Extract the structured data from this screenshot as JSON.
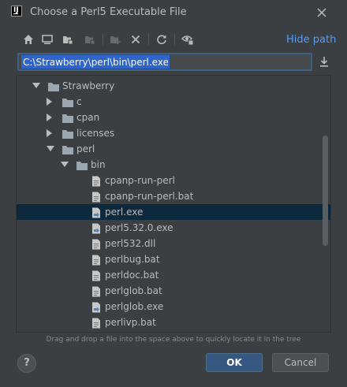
{
  "window": {
    "title": "Choose a Perl5 Executable File",
    "app_icon": "intellij-logo-icon"
  },
  "toolbar": {
    "buttons": [
      "home-icon",
      "desktop-icon",
      "project-folder-icon",
      "module-folder-icon",
      "new-folder-icon",
      "delete-icon",
      "refresh-icon",
      "show-hidden-icon"
    ],
    "hide_path_label": "Hide path"
  },
  "path": {
    "value": "C:\\Strawberry\\perl\\bin\\perl.exe"
  },
  "tree": {
    "rows": [
      {
        "label": "Strawberry",
        "type": "folder",
        "expanded": true
      },
      {
        "label": "c",
        "type": "folder",
        "expanded": false
      },
      {
        "label": "cpan",
        "type": "folder",
        "expanded": false
      },
      {
        "label": "licenses",
        "type": "folder",
        "expanded": false
      },
      {
        "label": "perl",
        "type": "folder",
        "expanded": true
      },
      {
        "label": "bin",
        "type": "folder",
        "expanded": true
      },
      {
        "label": "cpanp-run-perl",
        "type": "file"
      },
      {
        "label": "cpanp-run-perl.bat",
        "type": "file"
      },
      {
        "label": "perl.exe",
        "type": "exe",
        "selected": true
      },
      {
        "label": "perl5.32.0.exe",
        "type": "exe"
      },
      {
        "label": "perl532.dll",
        "type": "file"
      },
      {
        "label": "perlbug.bat",
        "type": "file"
      },
      {
        "label": "perldoc.bat",
        "type": "file"
      },
      {
        "label": "perlglob.bat",
        "type": "file"
      },
      {
        "label": "perlglob.exe",
        "type": "exe"
      },
      {
        "label": "perlivp.bat",
        "type": "file"
      }
    ]
  },
  "hint": "Drag and drop a file into the space above to quickly locate it in the tree",
  "buttons": {
    "help": "?",
    "ok": "OK",
    "cancel": "Cancel"
  },
  "colors": {
    "background": "#3c3f41",
    "selection": "#0d293e",
    "accent_link": "#589df6",
    "ok_button": "#365880"
  }
}
